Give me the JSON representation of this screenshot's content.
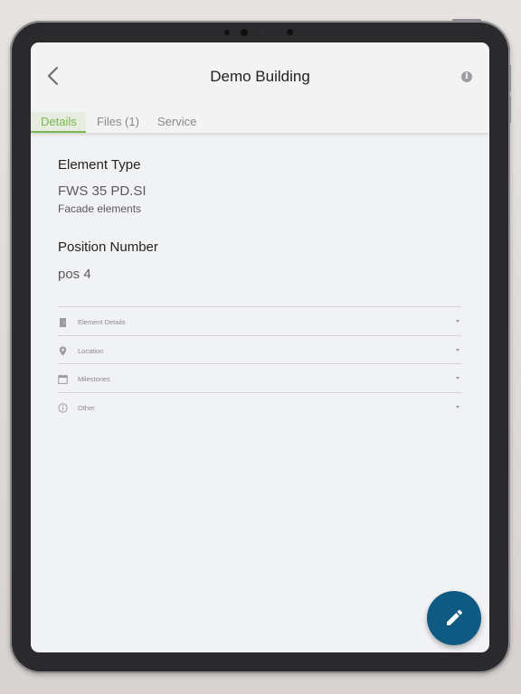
{
  "header": {
    "title": "Demo Building",
    "back_icon": "chevron-left-icon",
    "info_icon": "info-icon"
  },
  "tabs": [
    {
      "label": "Details",
      "active": true
    },
    {
      "label": "Files (1)",
      "active": false
    },
    {
      "label": "Service",
      "active": false
    }
  ],
  "element_type": {
    "label": "Element Type",
    "value": "FWS 35 PD.SI",
    "subtitle": "Facade elements"
  },
  "position_number": {
    "label": "Position Number",
    "value": "pos 4"
  },
  "sections": [
    {
      "label": "Element Details",
      "icon": "door-icon"
    },
    {
      "label": "Location",
      "icon": "location-pin-icon"
    },
    {
      "label": "Milestones",
      "icon": "calendar-icon"
    },
    {
      "label": "Other",
      "icon": "info-circle-icon"
    }
  ],
  "fab": {
    "icon": "pencil-icon"
  },
  "colors": {
    "accent": "#7ab74e",
    "fab": "#0f5a82",
    "background": "#f1f2f4"
  }
}
